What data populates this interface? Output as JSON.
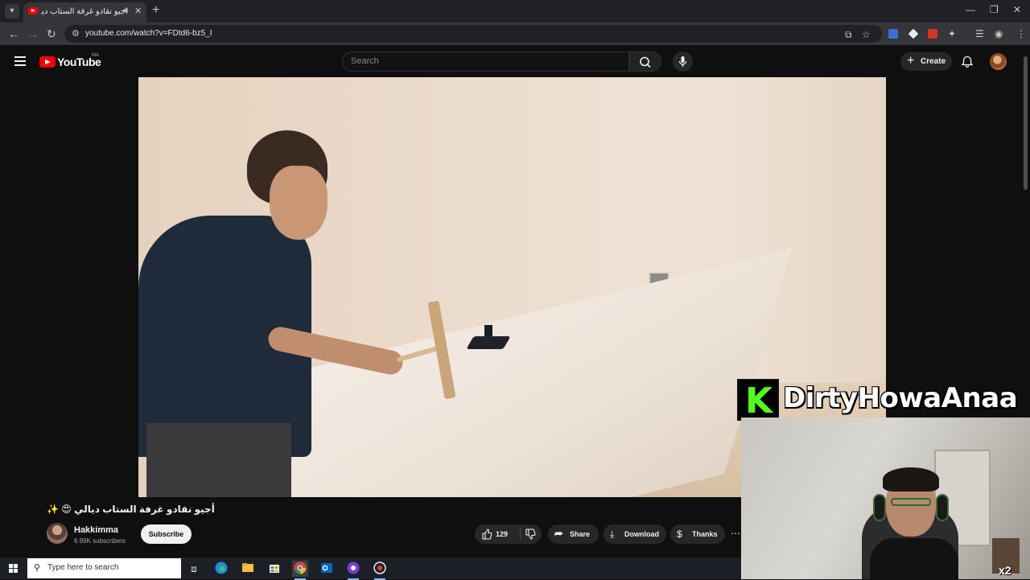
{
  "browser": {
    "tab_title": "أجيو نقادو غرفة الستاب ديالي",
    "url": "youtube.com/watch?v=FDtd6-bz5_I"
  },
  "youtube": {
    "logo_text": "YouTube",
    "country_code": "MA",
    "search_placeholder": "Search",
    "create_label": "Create"
  },
  "video": {
    "title": "أجيو نقادو غرفة الستاب ديالي 😍 ✨",
    "channel_name": "Hakkimma",
    "subscriber_count": "6.99K subscribers",
    "subscribe_label": "Subscribe",
    "like_count": "129",
    "actions": {
      "share": "Share",
      "download": "Download",
      "thanks": "Thanks"
    }
  },
  "overlay": {
    "kick_letter": "K",
    "streamer_handle": "DirtyHowaAnaa",
    "badge_text": "x2"
  },
  "taskbar": {
    "search_placeholder": "Type here to search"
  },
  "colors": {
    "yt_red": "#ff0000",
    "kick_green": "#53fc18",
    "page_bg": "#0f0f0f"
  },
  "icons": [
    "tab-list-icon",
    "youtube-favicon",
    "audio-icon",
    "tab-close-icon",
    "new-tab-icon",
    "minimize-icon",
    "restore-icon",
    "window-close-icon",
    "back-icon",
    "forward-icon",
    "reload-icon",
    "site-settings-icon",
    "install-app-icon",
    "bookmark-star-icon",
    "extensions-icon",
    "reading-list-icon",
    "profile-icon",
    "chrome-menu-icon",
    "hamburger-icon",
    "search-icon",
    "mic-icon",
    "plus-icon",
    "bell-icon",
    "like-icon",
    "dislike-icon",
    "share-icon",
    "download-icon",
    "thanks-icon",
    "more-icon",
    "windows-start-icon",
    "task-view-icon",
    "edge-icon",
    "file-explorer-icon",
    "store-icon",
    "chrome-icon",
    "outlook-icon",
    "app-icon"
  ]
}
